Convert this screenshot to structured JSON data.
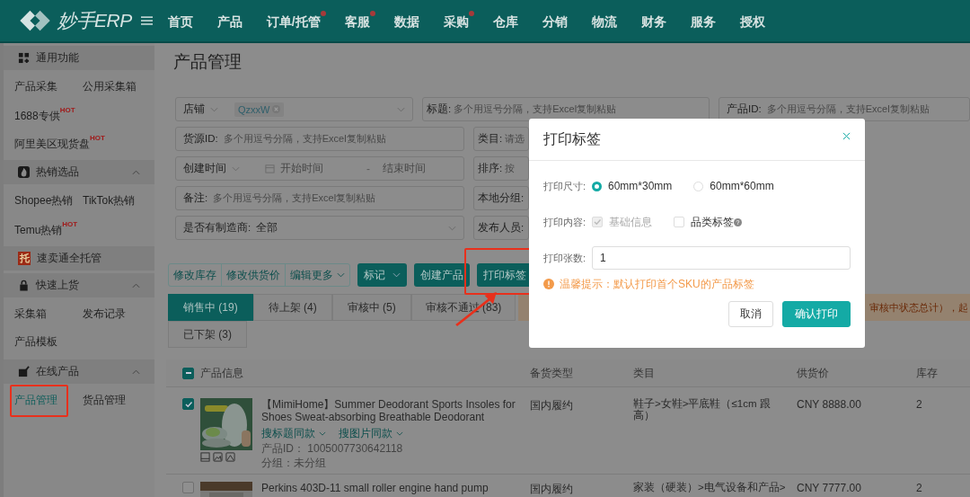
{
  "header": {
    "brand": "妙手ERP",
    "nav": [
      {
        "label": "首页",
        "badge": false
      },
      {
        "label": "产品",
        "badge": false
      },
      {
        "label": "订单/托管",
        "badge": true
      },
      {
        "label": "客服",
        "badge": true
      },
      {
        "label": "数据",
        "badge": false
      },
      {
        "label": "采购",
        "badge": true
      },
      {
        "label": "仓库",
        "badge": false
      },
      {
        "label": "分销",
        "badge": false
      },
      {
        "label": "物流",
        "badge": false
      },
      {
        "label": "财务",
        "badge": false
      },
      {
        "label": "服务",
        "badge": false
      },
      {
        "label": "授权",
        "badge": false
      }
    ]
  },
  "sidebar": [
    {
      "title": "通用功能",
      "collapsible": false,
      "items": [
        {
          "label": "产品采集",
          "selected": false,
          "highlighted": false
        },
        {
          "label": "公用采集箱",
          "selected": false,
          "highlighted": false
        },
        {
          "label": "1688专供",
          "hot": "HOT",
          "selected": false,
          "highlighted": false
        },
        {
          "label": "阿里美区现货盘",
          "hot": "HOT",
          "selected": false,
          "highlighted": false
        }
      ]
    },
    {
      "title": "热销选品",
      "collapsible": true,
      "items": [
        {
          "label": "Shopee热销",
          "selected": false,
          "highlighted": false
        },
        {
          "label": "TikTok热销",
          "selected": false,
          "highlighted": false
        },
        {
          "label": "Temu热销",
          "hot": "HOT",
          "selected": false,
          "highlighted": false
        }
      ]
    },
    {
      "title": "速卖通全托管",
      "icon_text": "托",
      "collapsible": false
    },
    {
      "title": "快速上货",
      "collapsible": true,
      "items": [
        {
          "label": "采集箱",
          "selected": false,
          "highlighted": false
        },
        {
          "label": "发布记录",
          "selected": false,
          "highlighted": false
        },
        {
          "label": "产品模板",
          "selected": false,
          "highlighted": false
        }
      ]
    },
    {
      "title": "在线产品",
      "collapsible": true,
      "items": [
        {
          "label": "产品管理",
          "selected": true,
          "highlighted": true
        },
        {
          "label": "货品管理",
          "selected": false,
          "highlighted": false
        }
      ]
    }
  ],
  "page_title": "产品管理",
  "filters": [
    [
      {
        "kind": "select",
        "label": "店铺",
        "tag": "QzxxW"
      },
      {
        "kind": "text",
        "label": "标题:",
        "placeholder": "多个用逗号分隔，支持Excel复制粘贴"
      },
      {
        "kind": "text",
        "label": "产品ID:",
        "placeholder": "多个用逗号分隔，支持Excel复制粘贴"
      }
    ],
    [
      {
        "kind": "text",
        "label": "货源ID:",
        "placeholder": "多个用逗号分隔，支持Excel复制粘贴"
      },
      {
        "kind": "text",
        "label": "类目:",
        "placeholder": "请选"
      }
    ],
    [
      {
        "kind": "daterange",
        "label": "创建时间",
        "start": {
          "placeholder": "开始时间"
        },
        "separator": "-",
        "end": {
          "placeholder": "结束时间"
        }
      },
      {
        "kind": "text",
        "label": "排序:",
        "placeholder": "按"
      }
    ],
    [
      {
        "kind": "text",
        "label": "备注:",
        "placeholder": "多个用逗号分隔，支持Excel复制粘贴"
      },
      {
        "kind": "text",
        "label": "本地分组:"
      }
    ],
    [
      {
        "kind": "dropdown",
        "label": "是否有制造商:",
        "value": "全部"
      },
      {
        "kind": "text",
        "label": "发布人员:"
      }
    ]
  ],
  "toolbar": {
    "group": [
      {
        "label": "修改库存",
        "caret": false
      },
      {
        "label": "修改供货价",
        "caret": false
      },
      {
        "label": "编辑更多",
        "caret": true
      }
    ],
    "buttons": [
      {
        "label": "标记",
        "caret": true,
        "highlighted": false
      },
      {
        "label": "创建产品",
        "caret": false,
        "highlighted": false
      },
      {
        "label": "打印标签",
        "caret": false,
        "highlighted": true
      }
    ]
  },
  "tabs": [
    {
      "label": "销售中 (19)",
      "selected": true
    },
    {
      "label": "待上架 (4)",
      "selected": false
    },
    {
      "label": "审核中 (5)",
      "selected": false
    },
    {
      "label": "审核不通过 (83)",
      "selected": false
    },
    {
      "label": "已下架 (3)",
      "selected": false
    }
  ],
  "notice": "审核中状态总计），起",
  "table": {
    "select_all": {
      "indeterminate": true
    },
    "columns": [
      "产品信息",
      "备货类型",
      "类目",
      "供货价",
      "库存"
    ],
    "rows": [
      {
        "checked": true,
        "title": "【MimiHome】Summer Deodorant Sports Insoles for Shoes Sweat-absorbing Breathable Deodorant",
        "links": [
          "搜标题同款",
          "搜图片同款"
        ],
        "product_id": "产品ID：  1005007730642118",
        "group": "分组：未分组",
        "fulfillment": "国内履约",
        "category": "鞋子>女鞋>平底鞋（≤1cm 跟高）",
        "price": "CNY 8888.00",
        "stock": "2"
      },
      {
        "checked": false,
        "title": "Perkins 403D-11 small roller engine hand pump",
        "fulfillment": "国内履约",
        "category": "家装（硬装）>电气设备和产品>",
        "price": "CNY 7777.00",
        "stock": "2"
      }
    ]
  },
  "dialog": {
    "title": "打印标签",
    "size": {
      "label": "打印尺寸:",
      "options": [
        {
          "label": "60mm*30mm",
          "selected": true
        },
        {
          "label": "60mm*60mm",
          "selected": false
        }
      ]
    },
    "content": {
      "label": "打印内容:",
      "options": [
        {
          "label": "基础信息",
          "checked": true,
          "disabled": true
        },
        {
          "label": "品类标签",
          "checked": false,
          "disabled": false,
          "help": "?"
        }
      ]
    },
    "count": {
      "label": "打印张数:",
      "value": "1"
    },
    "tip": "温馨提示：默认打印首个SKU的产品标签",
    "buttons": [
      {
        "label": "取消",
        "kind": "secondary"
      },
      {
        "label": "确认打印",
        "kind": "primary"
      }
    ]
  }
}
